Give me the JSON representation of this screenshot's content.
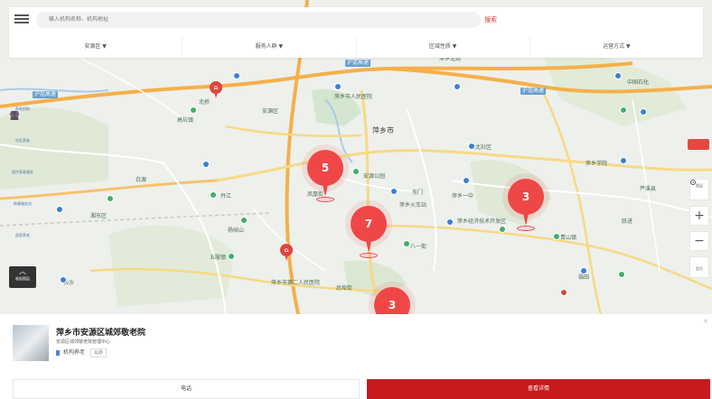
{
  "search": {
    "placeholder": "输入机构名称、机构地址",
    "button_label": "搜索"
  },
  "filters": [
    {
      "label": "安源区 ▼"
    },
    {
      "label": "服务人群 ▼"
    },
    {
      "label": "区域性质 ▼"
    },
    {
      "label": "运营方式 ▼"
    }
  ],
  "left_tools": [
    {
      "label": "养老机构",
      "icon": "building-icon"
    },
    {
      "label": "社区养老",
      "icon": "shield-icon"
    },
    {
      "label": "医疗养老服务",
      "icon": "heart-icon"
    },
    {
      "label": "助餐服务点",
      "icon": "bowl-icon"
    },
    {
      "label": "居家养老",
      "icon": "person-icon"
    }
  ],
  "expand_label": "收起图层",
  "clusters": [
    {
      "count": "5"
    },
    {
      "count": "7"
    },
    {
      "count": "3"
    },
    {
      "count": "3"
    }
  ],
  "map": {
    "city_label": "萍乡市",
    "labels": [
      "沪昆高速",
      "安源区",
      "萍乡火车站",
      "湘东区",
      "芦溪县",
      "北桥",
      "萍乡市人民医院",
      "安源公园",
      "萍乡北站",
      "中国石化",
      "萍乡一中",
      "城北社区",
      "东门",
      "五陂镇",
      "白源",
      "高坑镇",
      "青山镇",
      "丹江",
      "跃进",
      "福田",
      "凤凰街",
      "八一街",
      "后埠街",
      "萍乡经济技术开发区",
      "萍乡市第二人民医院",
      "长沙",
      "萍乡学院",
      "杨岐山"
    ]
  },
  "right_controls": {
    "layer_label": "图层",
    "zoom_in": "+",
    "zoom_out": "−",
    "locate_label": "定位"
  },
  "card": {
    "title": "萍乡市安源区城郊敬老院",
    "address": "安源区城郊敬老院管理中心",
    "type": "机构养老",
    "ownership": "公办",
    "phone_label": "电话",
    "detail_label": "查看详情"
  },
  "colors": {
    "accent": "#c8191e",
    "cluster": "#ef4747",
    "search_text": "#d43a2f"
  }
}
